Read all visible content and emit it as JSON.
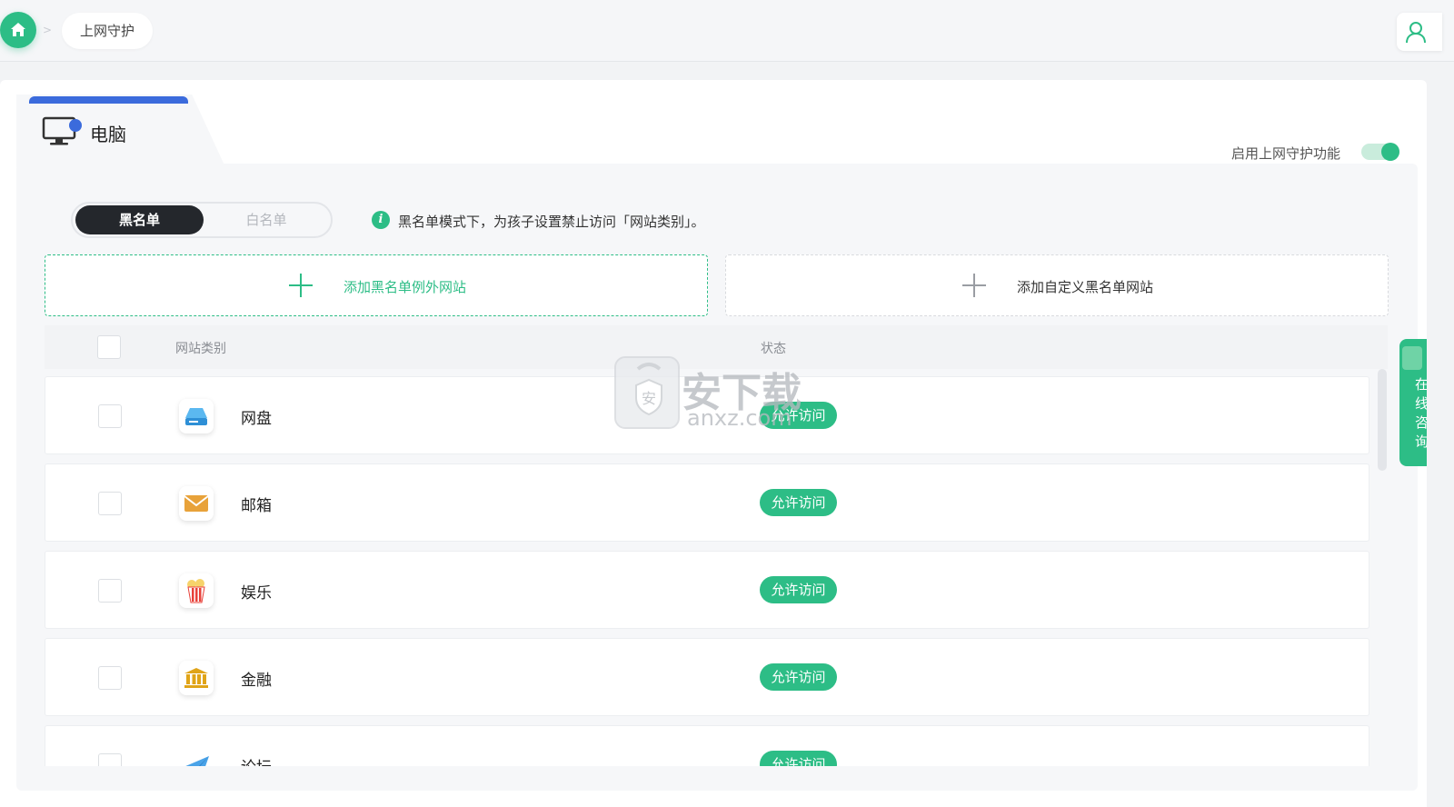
{
  "breadcrumb": {
    "current": "上网守护",
    "separator": ">"
  },
  "device_tab": {
    "label": "电脑"
  },
  "guard_toggle": {
    "label": "启用上网守护功能",
    "enabled": true
  },
  "mode_switch": {
    "blacklist": "黑名单",
    "whitelist": "白名单",
    "selected": "黑名单"
  },
  "info": {
    "text": "黑名单模式下，为孩子设置禁止访问「网站类别」。"
  },
  "add_buttons": {
    "exception": "添加黑名单例外网站",
    "custom": "添加自定义黑名单网站"
  },
  "table": {
    "headers": {
      "category": "网站类别",
      "status": "状态"
    },
    "rows": [
      {
        "icon": "cloud-drive-icon",
        "name": "网盘",
        "status": "允许访问"
      },
      {
        "icon": "mail-icon",
        "name": "邮箱",
        "status": "允许访问"
      },
      {
        "icon": "popcorn-icon",
        "name": "娱乐",
        "status": "允许访问"
      },
      {
        "icon": "bank-icon",
        "name": "金融",
        "status": "允许访问"
      },
      {
        "icon": "paper-plane-icon",
        "name": "论坛",
        "status": "允许访问"
      }
    ]
  },
  "consult_tab": {
    "label": "在线咨询"
  },
  "watermark": {
    "cn": "安下载",
    "en": "anxz.com"
  },
  "colors": {
    "accent": "#2dbd86",
    "tab_bar": "#3b6bdc",
    "dark_pill": "#24272c"
  }
}
